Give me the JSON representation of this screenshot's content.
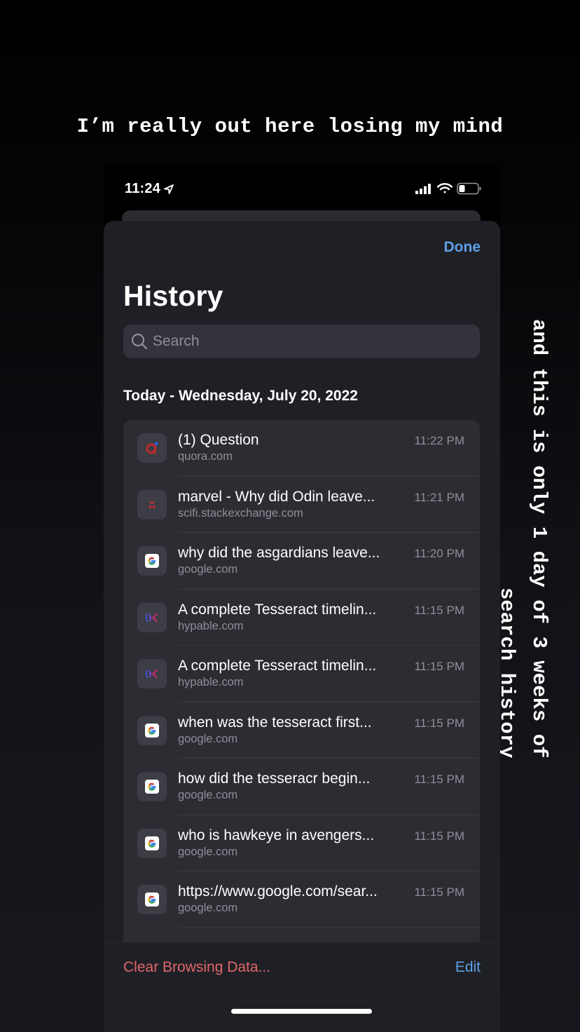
{
  "captions": {
    "top": "I’m really out here losing my mind",
    "side_line1": "and this is only 1 day of 3 weeks of",
    "side_line2": "search history"
  },
  "status_bar": {
    "time": "11:24",
    "location_icon": "location-arrow-icon",
    "signal_icon": "cellular-signal-icon",
    "wifi_icon": "wifi-icon",
    "battery_icon": "battery-low-icon",
    "battery_level": 0.25
  },
  "sheet": {
    "done_label": "Done",
    "title": "History",
    "search_placeholder": "Search",
    "section_header": "Today - Wednesday, July 20, 2022"
  },
  "history": [
    {
      "title": "(1) Question",
      "domain": "quora.com",
      "time": "11:22 PM",
      "icon": "quora"
    },
    {
      "title": "marvel - Why did Odin leave...",
      "domain": "scifi.stackexchange.com",
      "time": "11:21 PM",
      "icon": "stackexchange"
    },
    {
      "title": "why did the asgardians leave...",
      "domain": "google.com",
      "time": "11:20 PM",
      "icon": "google"
    },
    {
      "title": "A complete Tesseract timelin...",
      "domain": "hypable.com",
      "time": "11:15 PM",
      "icon": "hypable"
    },
    {
      "title": "A complete Tesseract timelin...",
      "domain": "hypable.com",
      "time": "11:15 PM",
      "icon": "hypable"
    },
    {
      "title": "when was the tesseract first...",
      "domain": "google.com",
      "time": "11:15 PM",
      "icon": "google"
    },
    {
      "title": "how did the tesseracr begin...",
      "domain": "google.com",
      "time": "11:15 PM",
      "icon": "google"
    },
    {
      "title": "who is hawkeye in avengers...",
      "domain": "google.com",
      "time": "11:15 PM",
      "icon": "google"
    },
    {
      "title": "https://www.google.com/sear...",
      "domain": "google.com",
      "time": "11:15 PM",
      "icon": "google"
    }
  ],
  "toolbar": {
    "clear_label": "Clear Browsing Data...",
    "edit_label": "Edit"
  },
  "colors": {
    "accent_blue": "#5f9fe8",
    "destructive_red": "#e2676b",
    "sheet_bg": "#1f2025",
    "list_bg": "#2c2d33"
  }
}
